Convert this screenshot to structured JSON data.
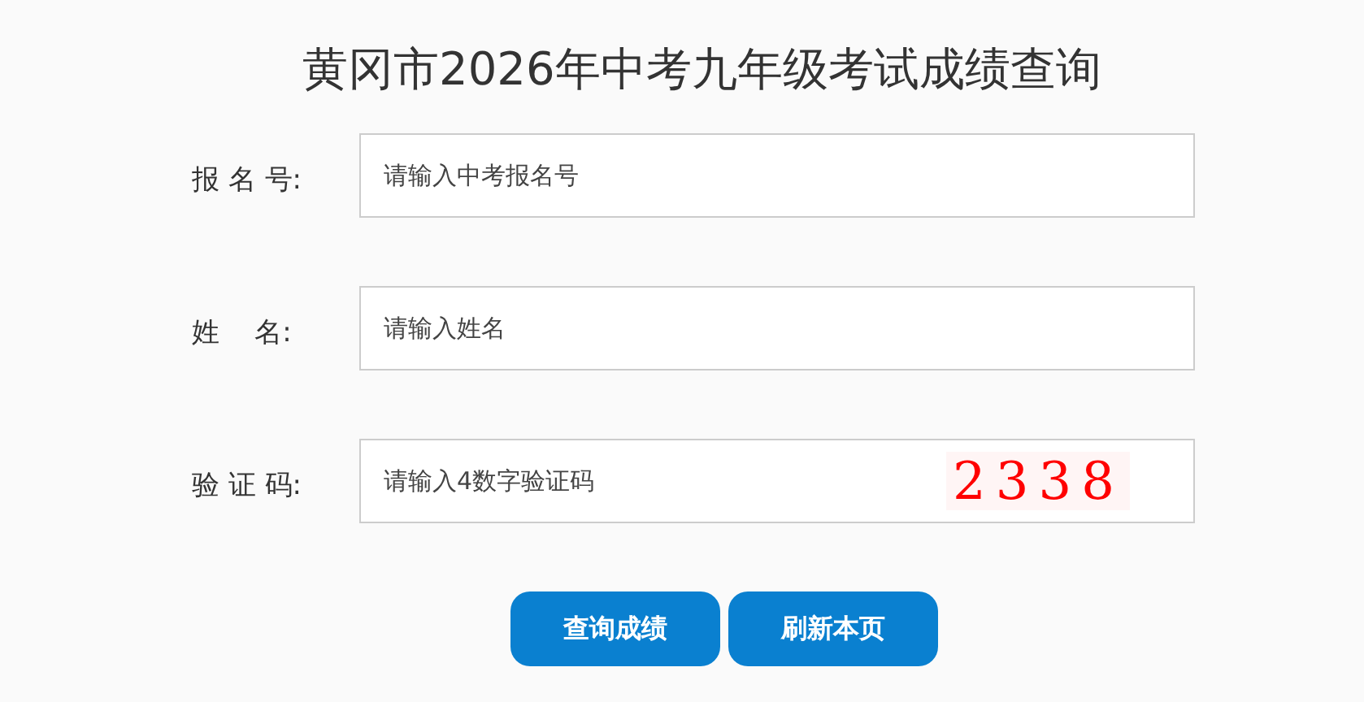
{
  "title": "黄冈市2026年中考九年级考试成绩查询",
  "fields": [
    {
      "label": "报 名 号:",
      "placeholder": "请输入中考报名号"
    },
    {
      "label": "姓    名:",
      "placeholder": "请输入姓名"
    },
    {
      "label": "验 证 码:",
      "placeholder": "请输入4数字验证码",
      "captcha": "2338"
    }
  ],
  "buttons": [
    "查询成绩",
    "刷新本页"
  ]
}
